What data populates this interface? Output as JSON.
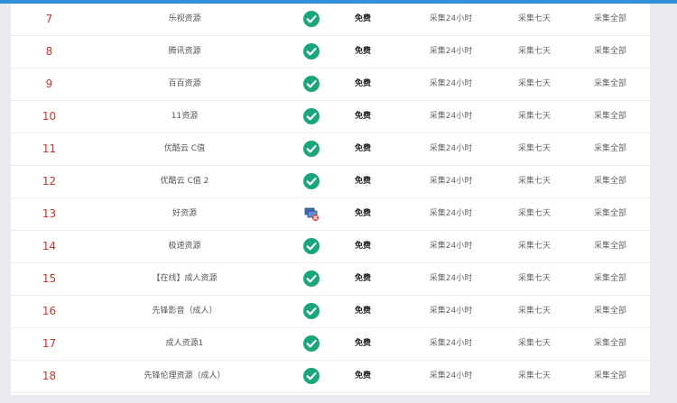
{
  "colors": {
    "accent": "#2f8fd8",
    "index": "#c0392b",
    "ok": "#1aa57a",
    "error": "#e53935"
  },
  "rows": [
    {
      "num": "7",
      "name": "乐视资源",
      "status": "ok",
      "status_icon": "check-circle-icon",
      "fee": "免费",
      "day": "采集24小时",
      "week": "采集七天",
      "all": "采集全部"
    },
    {
      "num": "8",
      "name": "腾讯资源",
      "status": "ok",
      "status_icon": "check-circle-icon",
      "fee": "免费",
      "day": "采集24小时",
      "week": "采集七天",
      "all": "采集全部"
    },
    {
      "num": "9",
      "name": "百百资源",
      "status": "ok",
      "status_icon": "check-circle-icon",
      "fee": "免费",
      "day": "采集24小时",
      "week": "采集七天",
      "all": "采集全部"
    },
    {
      "num": "10",
      "name": "11资源",
      "status": "ok",
      "status_icon": "check-circle-icon",
      "fee": "免费",
      "day": "采集24小时",
      "week": "采集七天",
      "all": "采集全部"
    },
    {
      "num": "11",
      "name": "优酷云 C值",
      "status": "ok",
      "status_icon": "check-circle-icon",
      "fee": "免费",
      "day": "采集24小时",
      "week": "采集七天",
      "all": "采集全部"
    },
    {
      "num": "12",
      "name": "优酷云 C值 2",
      "status": "ok",
      "status_icon": "check-circle-icon",
      "fee": "免费",
      "day": "采集24小时",
      "week": "采集七天",
      "all": "采集全部"
    },
    {
      "num": "13",
      "name": "好资源",
      "status": "error",
      "status_icon": "network-error-icon",
      "fee": "免费",
      "day": "采集24小时",
      "week": "采集七天",
      "all": "采集全部"
    },
    {
      "num": "14",
      "name": "极速资源",
      "status": "ok",
      "status_icon": "check-circle-icon",
      "fee": "免费",
      "day": "采集24小时",
      "week": "采集七天",
      "all": "采集全部"
    },
    {
      "num": "15",
      "name": "【在线】成人资源",
      "status": "ok",
      "status_icon": "check-circle-icon",
      "fee": "免费",
      "day": "采集24小时",
      "week": "采集七天",
      "all": "采集全部"
    },
    {
      "num": "16",
      "name": "先锋影音（成人）",
      "status": "ok",
      "status_icon": "check-circle-icon",
      "fee": "免费",
      "day": "采集24小时",
      "week": "采集七天",
      "all": "采集全部"
    },
    {
      "num": "17",
      "name": "成人资源1",
      "status": "ok",
      "status_icon": "check-circle-icon",
      "fee": "免费",
      "day": "采集24小时",
      "week": "采集七天",
      "all": "采集全部"
    },
    {
      "num": "18",
      "name": "先锋伦理资源（成人）",
      "status": "ok",
      "status_icon": "check-circle-icon",
      "fee": "免费",
      "day": "采集24小时",
      "week": "采集七天",
      "all": "采集全部"
    }
  ]
}
